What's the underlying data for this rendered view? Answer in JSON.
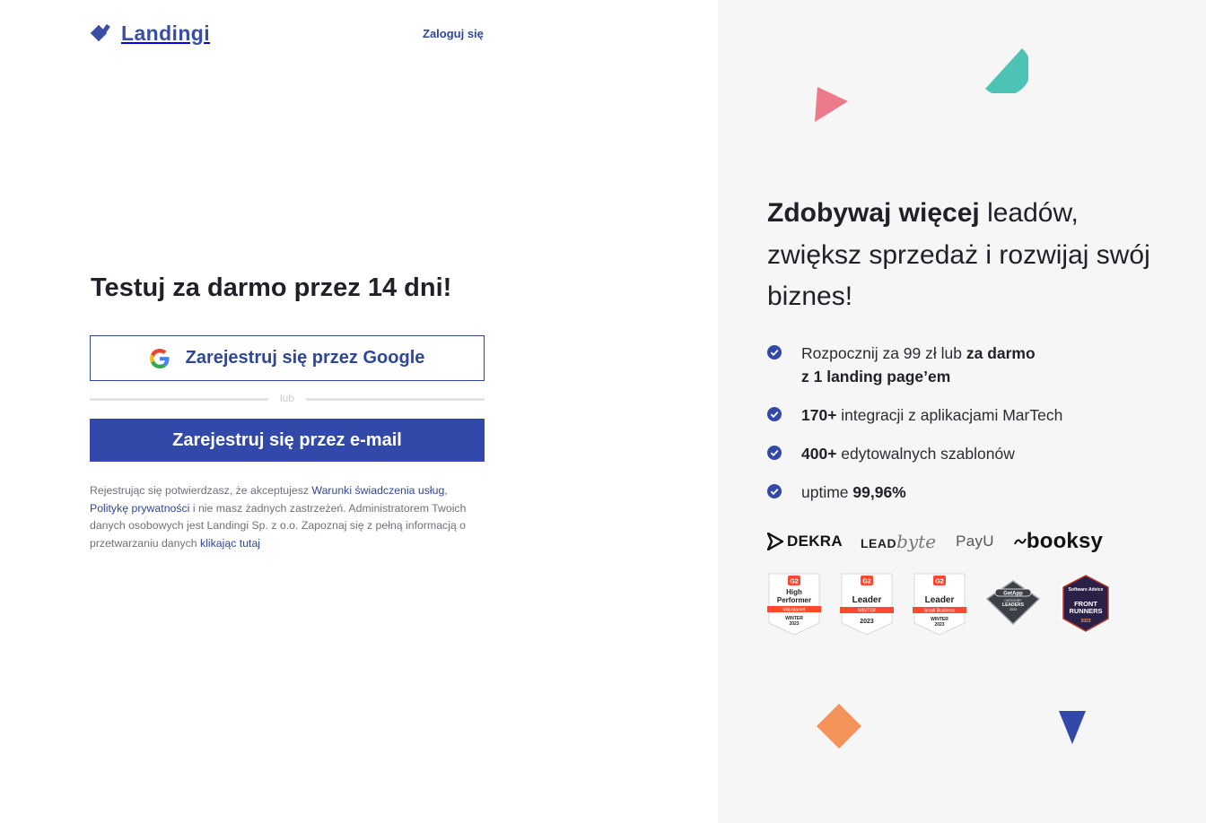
{
  "header": {
    "logo_text": "Landingi",
    "login_link": "Zaloguj się"
  },
  "signup": {
    "title": "Testuj za darmo przez 14 dni!",
    "google_button": "Zarejestruj się przez Google",
    "divider_text": "lub",
    "email_button": "Zarejestruj się przez e-mail",
    "legal": {
      "part1": "Rejestrując się potwierdzasz, że akceptujesz ",
      "terms_link": "Warunki świadczenia usług",
      "part2": ", ",
      "privacy_link": "Politykę prywatności",
      "part3": " i nie masz żadnych zastrzeżeń. Administratorem Twoich danych osobowych jest Landingi Sp. z o.o. Zapoznaj się z pełną informacją o przetwarzaniu danych ",
      "click_link": "klikając tutaj"
    }
  },
  "promo": {
    "tagline_bold": "Zdobywaj więcej",
    "tagline_rest": " leadów, zwiększ sprzedaż i rozwijaj swój biznes!",
    "benefits": [
      {
        "pre": "Rozpocznij za 99 zł lub ",
        "bold": "za darmo",
        "post": "",
        "line2_bold": "z 1 landing page’em"
      },
      {
        "pre": "",
        "bold": "170+",
        "post": " integracji z aplikacjami MarTech"
      },
      {
        "pre": "",
        "bold": "400+",
        "post": " edytowalnych szablonów"
      },
      {
        "pre": "uptime ",
        "bold": "99,96%",
        "post": ""
      }
    ],
    "client_logos": {
      "dekra": "DEKRA",
      "leadbyte_lead": "LEAD",
      "leadbyte_byte": "byte",
      "payu": "PayU",
      "booksy": "booksy"
    },
    "badges": [
      {
        "brand": "G2",
        "line1": "High",
        "line2": "Performer",
        "ribbon": "Mid-Market",
        "season": "WINTER",
        "year": "2023"
      },
      {
        "brand": "G2",
        "line1": "Leader",
        "line2": "",
        "ribbon": "WINTER",
        "season": "",
        "year": "2023"
      },
      {
        "brand": "G2",
        "line1": "Leader",
        "line2": "",
        "ribbon": "Small Business",
        "season": "WINTER",
        "year": "2023"
      },
      {
        "brand": "GetApp",
        "line1": "CATEGORY",
        "line2": "LEADERS",
        "year": "2023"
      },
      {
        "brand": "Software Advice",
        "line1": "FRONT",
        "line2": "RUNNERS",
        "year": "2023"
      }
    ]
  },
  "colors": {
    "brand_blue": "#3349a9",
    "link_blue": "#2f4798",
    "right_bg": "#f6f6f7",
    "deco_pink": "#ec7a8a",
    "deco_teal": "#4cc3b5",
    "deco_orange": "#f4935a",
    "deco_blue": "#3349a9"
  }
}
